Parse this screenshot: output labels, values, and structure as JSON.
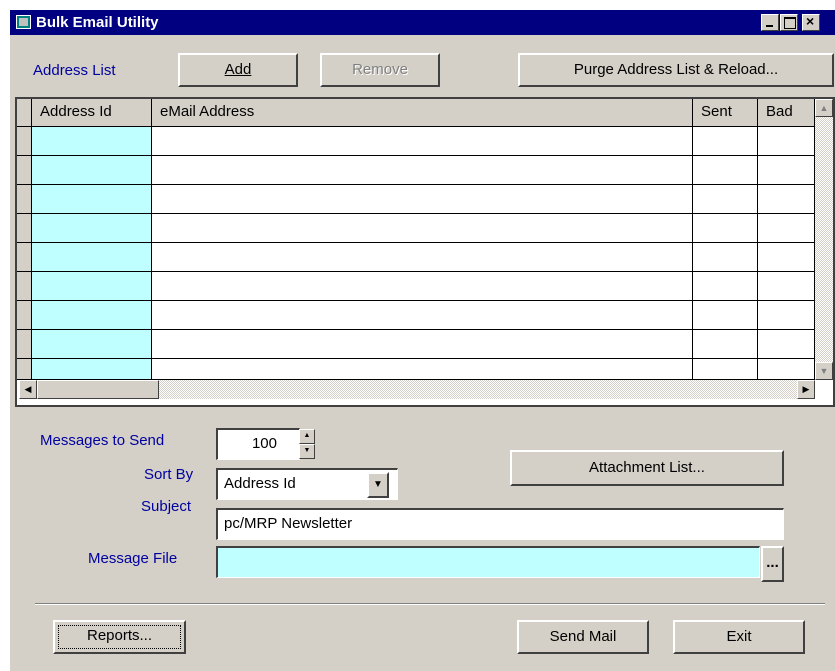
{
  "window": {
    "title": "Bulk Email Utility"
  },
  "address_list": {
    "label": "Address List",
    "add_label": "Add",
    "remove_label": "Remove",
    "purge_label": "Purge Address List & Reload..."
  },
  "grid": {
    "columns": [
      "Address Id",
      "eMail Address",
      "Sent",
      "Bad"
    ],
    "rows": []
  },
  "messages": {
    "label": "Messages to Send",
    "value": "100"
  },
  "sort": {
    "label": "Sort By",
    "value": "Address Id"
  },
  "subject": {
    "label": "Subject",
    "value": "pc/MRP Newsletter"
  },
  "message_file": {
    "label": "Message File",
    "value": "",
    "browse_label": "..."
  },
  "attachment_label": "Attachment List...",
  "footer": {
    "reports_label": "Reports...",
    "send_label": "Send Mail",
    "exit_label": "Exit"
  },
  "colors": {
    "titlebar": "#000080",
    "label": "#0000a0",
    "key_column": "#c0ffff",
    "face": "#d4d0c8"
  }
}
